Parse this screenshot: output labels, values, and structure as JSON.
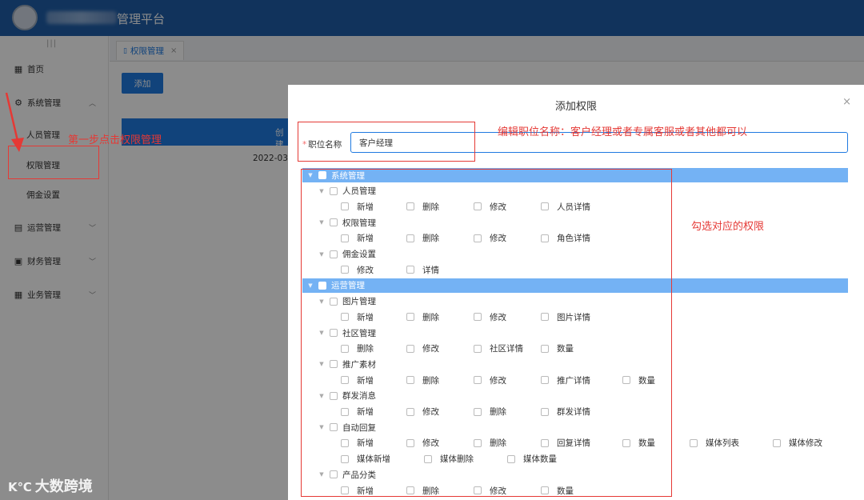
{
  "app": {
    "title": "管理平台"
  },
  "sidebar": {
    "items": [
      {
        "icon": "grid-icon",
        "label": "首页"
      },
      {
        "icon": "gear-icon",
        "label": "系统管理"
      },
      {
        "label": "人员管理"
      },
      {
        "label": "权限管理"
      },
      {
        "label": "佣金设置"
      },
      {
        "icon": "document-icon",
        "label": "运营管理"
      },
      {
        "icon": "finance-icon",
        "label": "财务管理"
      },
      {
        "icon": "apps-icon",
        "label": "业务管理"
      }
    ]
  },
  "tabs": [
    {
      "label": "权限管理",
      "close": "×"
    }
  ],
  "toolbar": {
    "add_label": "添加"
  },
  "table": {
    "header_partial": "创建",
    "cell_partial": "2022-03"
  },
  "modal": {
    "title": "添加权限",
    "close": "×",
    "field_label": "职位名称",
    "required_mark": "*",
    "field_value": "客户经理",
    "groups": [
      {
        "label": "系统管理",
        "children": [
          {
            "label": "人员管理",
            "perms": [
              "新增",
              "删除",
              "修改",
              "人员详情"
            ]
          },
          {
            "label": "权限管理",
            "perms": [
              "新增",
              "删除",
              "修改",
              "角色详情"
            ]
          },
          {
            "label": "佣金设置",
            "perms": [
              "修改",
              "详情"
            ]
          }
        ]
      },
      {
        "label": "运营管理",
        "children": [
          {
            "label": "图片管理",
            "perms": [
              "新增",
              "删除",
              "修改",
              "图片详情"
            ]
          },
          {
            "label": "社区管理",
            "perms": [
              "删除",
              "修改",
              "社区详情",
              "数量"
            ]
          },
          {
            "label": "推广素材",
            "perms": [
              "新增",
              "删除",
              "修改",
              "推广详情",
              "数量"
            ]
          },
          {
            "label": "群发消息",
            "perms": [
              "新增",
              "修改",
              "删除",
              "群发详情"
            ]
          },
          {
            "label": "自动回复",
            "perms": [
              "新增",
              "修改",
              "删除",
              "回复详情",
              "数量",
              "媒体列表",
              "媒体修改",
              "媒体新增",
              "媒体删除",
              "媒体数量"
            ]
          },
          {
            "label": "产品分类",
            "perms": [
              "新增",
              "删除",
              "修改",
              "数量"
            ]
          }
        ]
      }
    ]
  },
  "annotations": {
    "step1": "第一步点击权限管理",
    "edit_name": "编辑职位名称：客户经理或者专属客服或者其他都可以",
    "check_perms": "勾选对应的权限",
    "color": "#e53935"
  },
  "watermark": {
    "logo": "K℃",
    "text": "大数跨境"
  }
}
